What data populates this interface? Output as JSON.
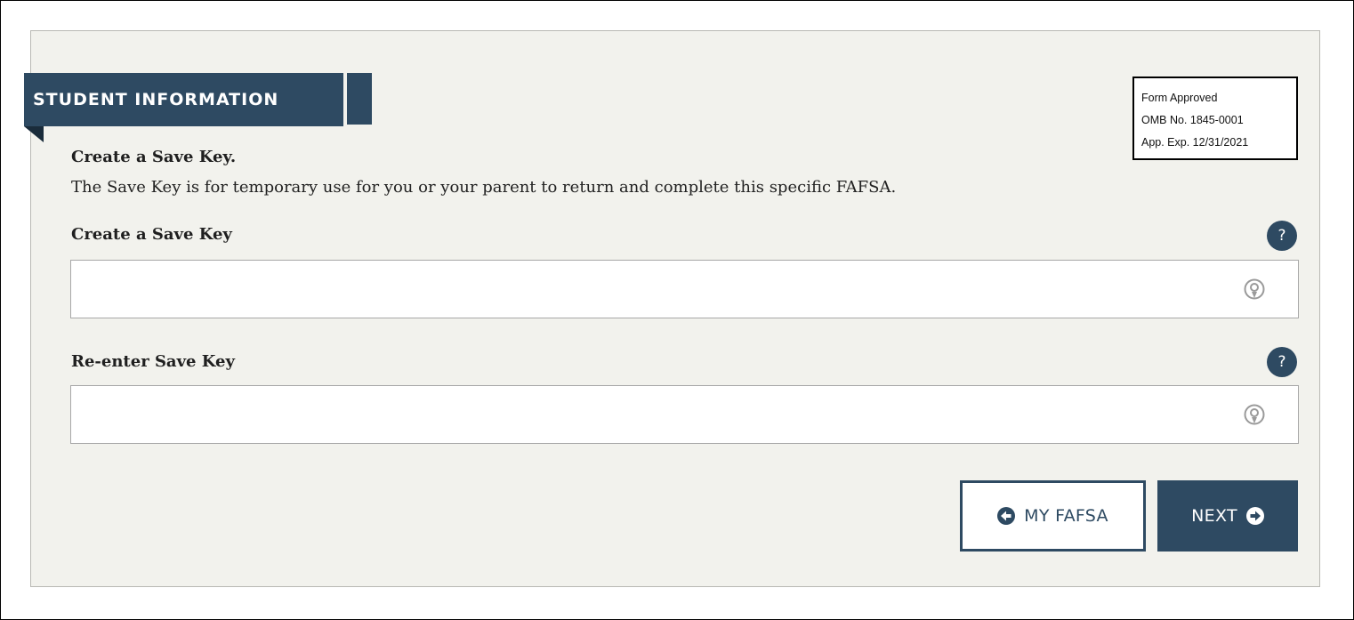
{
  "section": {
    "banner_title": "STUDENT INFORMATION"
  },
  "omb": {
    "line1": "Form Approved",
    "line2": "OMB No. 1845-0001",
    "line3": "App. Exp. 12/31/2021"
  },
  "content": {
    "heading": "Create a Save Key.",
    "description": "The Save Key is for temporary use for you or your parent to return and complete this specific FAFSA."
  },
  "fields": {
    "save_key": {
      "label": "Create a Save Key",
      "value": "",
      "help_symbol": "?",
      "reveal_icon": "eye-reveal-icon"
    },
    "reenter_save_key": {
      "label": "Re-enter Save Key",
      "value": "",
      "help_symbol": "?",
      "reveal_icon": "eye-reveal-icon"
    }
  },
  "buttons": {
    "back_label": "MY FAFSA",
    "back_icon": "arrow-left-circle-icon",
    "next_label": "NEXT",
    "next_icon": "arrow-right-circle-icon"
  },
  "colors": {
    "brand": "#2e4a62",
    "panel_bg": "#f2f2ed"
  }
}
